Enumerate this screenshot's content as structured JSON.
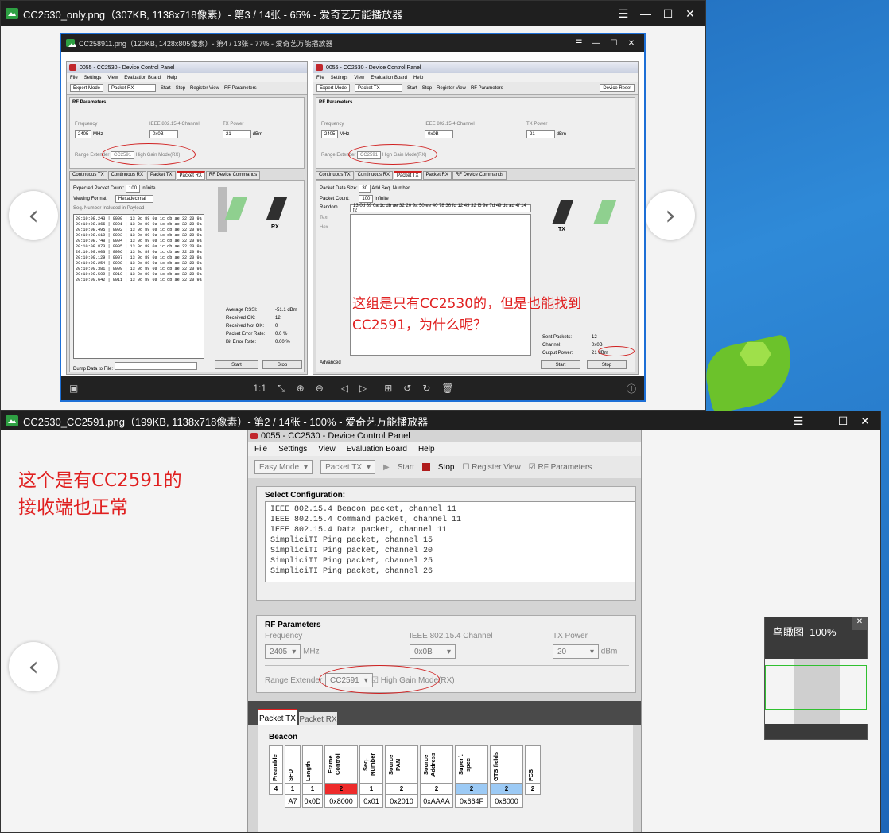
{
  "top_viewer": {
    "title": "CC2530_only.png（307KB, 1138x718像素）- 第3 / 14张 - 65% - 爱奇艺万能播放器",
    "controls": [
      "☰",
      "—",
      "☐",
      "✕"
    ],
    "prev": "‹",
    "next": "›",
    "inner_title": "CC258911.png（120KB, 1428x805像素）- 第4 / 13张 - 77% - 爱奇艺万能播放器",
    "toolbar": [
      "1:1",
      "⤡",
      "⊕",
      "⊖",
      "◁",
      "▷",
      "⊞",
      "↺",
      "↻",
      "🗑",
      "ⓘ"
    ],
    "left_panel": {
      "title": "0055 - CC2530 - Device Control Panel",
      "menu": [
        "File",
        "Settings",
        "View",
        "Evaluation Board",
        "Help"
      ],
      "mode": "Expert Mode",
      "packet": "Packet RX",
      "start": "Start",
      "stop": "Stop",
      "register_view": "Register View",
      "rf_params_cb": "RF Parameters",
      "rf_title": "RF Parameters",
      "freq_label": "Frequency",
      "freq": "2405",
      "freq_unit": "MHz",
      "chan_label": "IEEE 802.15.4 Channel",
      "chan": "0x0B",
      "txp_label": "TX Power",
      "txp": "21",
      "txp_unit": "dBm",
      "range_label": "Range Extender",
      "range": "CC2591",
      "hgm": "High Gain Mode(RX)",
      "tabs": [
        "Continuous TX",
        "Continuous RX",
        "Packet TX",
        "Packet RX",
        "RF Device Commands"
      ],
      "exp_count_label": "Expected Packet Count:",
      "exp_count": "100",
      "infinite": "Infinite",
      "view_fmt_label": "Viewing Format:",
      "view_fmt": "Hexadecimal",
      "seq_incl": "Seq. Number Included in Payload",
      "log": [
        "20:10:08.243 | 0000 | 13 0d 89 0a 1c db ae 32 20 9a 50 ee 40 78 36",
        "20:10:08.366 | 0001 | 13 0d 89 0a 1c db ae 32 20 9a 50 ee 40 78 36",
        "20:10:08.495 | 0002 | 13 0d 89 0a 1c db ae 32 20 9a 50 ee 40 78 36",
        "20:10:08.619 | 0003 | 13 0d 89 0a 1c db ae 32 20 9a 50 ee 40 78 36",
        "20:10:08.748 | 0004 | 13 0d 89 0a 1c db ae 32 20 9a 50 ee 40 78 36",
        "20:10:08.873 | 0005 | 13 0d 89 0a 1c db ae 32 20 9a 50 ee 40 78 36",
        "20:10:09.003 | 0006 | 13 0d 89 0a 1c db ae 32 20 9a 50 ee 40 78 36",
        "20:10:09.129 | 0007 | 13 0d 89 0a 1c db ae 32 20 9a 50 ee 40 78 36",
        "20:10:09.254 | 0008 | 13 0d 89 0a 1c db ae 32 20 9a 50 ee 40 78 36",
        "20:10:09.381 | 0009 | 13 0d 89 0a 1c db ae 32 20 9a 50 ee 40 78 36",
        "20:10:09.509 | 0010 | 13 0d 89 0a 1c db ae 32 20 9a 50 ee 40 78 36",
        "20:10:09.642 | 0011 | 13 0d 89 0a 1c db ae 32 20 9a 50 ee 40 78 36"
      ],
      "rx_label": "RX",
      "stats": [
        [
          "Average RSSI:",
          "-51.1 dBm"
        ],
        [
          "Received OK:",
          "12"
        ],
        [
          "Received Not OK:",
          "0"
        ],
        [
          "Packet Error Rate:",
          "0.0 %"
        ],
        [
          "Bit Error Rate:",
          "0.00 %"
        ]
      ],
      "dump_label": "Dump Data to File:",
      "btn_start": "Start",
      "btn_stop": "Stop"
    },
    "right_panel": {
      "title": "0056 - CC2530 - Device Control Panel",
      "menu": [
        "File",
        "Settings",
        "View",
        "Evaluation Board",
        "Help"
      ],
      "mode": "Expert Mode",
      "packet": "Packet TX",
      "start": "Start",
      "stop": "Stop",
      "register_view": "Register View",
      "rf_params_cb": "RF Parameters",
      "device_reset": "Device Reset",
      "rf_title": "RF Parameters",
      "freq_label": "Frequency",
      "freq": "2405",
      "freq_unit": "MHz",
      "chan_label": "IEEE 802.15.4 Channel",
      "chan": "0x0B",
      "txp_label": "TX Power",
      "txp": "21",
      "txp_unit": "dBm",
      "range_label": "Range Extender",
      "range": "CC2591",
      "hgm": "High Gain Mode(RX)",
      "tabs": [
        "Continuous TX",
        "Continuous RX",
        "Packet TX",
        "Packet RX",
        "RF Device Commands"
      ],
      "data_size_label": "Packet Data Size:",
      "data_size": "30",
      "add_seq": "Add Seq. Number",
      "count_label": "Packet Count:",
      "count": "100",
      "infinite": "Infinite",
      "random": "Random",
      "random_val": "13 0d 89 0a 1c db ae 32 20 9a 50 ee 40 78 36 fd 12 49 32 f6 9e 7d 49 dc ad 4f 14 f2",
      "text_opt": "Text",
      "hex_opt": "Hex",
      "tx_label": "TX",
      "stats": [
        [
          "Sent Packets:",
          "12"
        ],
        [
          "Channel:",
          "0x0B"
        ],
        [
          "Output Power:",
          "21 dBm"
        ]
      ],
      "advanced": "Advanced",
      "btn_start": "Start",
      "btn_stop": "Stop",
      "status_mid": "SmartRF1403",
      "status_right": "Radio State: 9.4"
    },
    "annotation_line1": "这组是只有CC2530的，但是也能找到",
    "annotation_line2": "CC2591，为什么呢？"
  },
  "bottom_viewer": {
    "title": "CC2530_CC2591.png（199KB, 1138x718像素）- 第2 / 14张 - 100% - 爱奇艺万能播放器",
    "controls": [
      "☰",
      "—",
      "☐",
      "✕"
    ],
    "prev": "‹",
    "annotation_line1": "这个是有CC2591的",
    "annotation_line2": "接收端也正常",
    "panel": {
      "title": "0055 - CC2530 - Device Control Panel",
      "menu": [
        "File",
        "Settings",
        "View",
        "Evaluation Board",
        "Help"
      ],
      "mode": "Easy Mode",
      "packet": "Packet TX",
      "start": "Start",
      "stop": "Stop",
      "register_view": "Register View",
      "rf_params_cb": "RF Parameters",
      "select_title": "Select Configuration:",
      "configs": [
        "IEEE 802.15.4 Beacon packet, channel 11",
        "IEEE 802.15.4 Command packet, channel 11",
        "IEEE 802.15.4 Data packet, channel 11",
        "SimpliciTI Ping packet, channel 15",
        "SimpliciTI Ping packet, channel 20",
        "SimpliciTI Ping packet, channel 25",
        "SimpliciTI Ping packet, channel 26"
      ],
      "rf_title": "RF Parameters",
      "freq_label": "Frequency",
      "freq": "2405",
      "freq_unit": "MHz",
      "chan_label": "IEEE 802.15.4 Channel",
      "chan": "0x0B",
      "txp_label": "TX Power",
      "txp": "20",
      "txp_unit": "dBm",
      "range_label": "Range Extender",
      "range": "CC2591",
      "hgm": "High Gain Mode(RX)",
      "tabs": [
        "Packet TX",
        "Packet RX"
      ],
      "beacon_title": "Beacon",
      "frame_fields": [
        {
          "name": "Preamble",
          "len": "4",
          "val": "",
          "color": "#ffffff"
        },
        {
          "name": "SFD",
          "len": "1",
          "val": "A7",
          "color": "#ffffff"
        },
        {
          "name": "Length",
          "len": "1",
          "val": "0x0D",
          "color": "#ffffff"
        },
        {
          "name": "Frame Control",
          "len": "2",
          "val": "0x8000",
          "color": "#ee2b2b"
        },
        {
          "name": "Seq. Number",
          "len": "1",
          "val": "0x01",
          "color": "#ffffff"
        },
        {
          "name": "Source PAN",
          "len": "2",
          "val": "0x2010",
          "color": "#ffffff"
        },
        {
          "name": "Source Address",
          "len": "2",
          "val": "0xAAAA",
          "color": "#ffffff"
        },
        {
          "name": "Superf. spec",
          "len": "2",
          "val": "0x664F",
          "color": "#9ccaf5"
        },
        {
          "name": "GTS fields",
          "len": "2",
          "val": "0x8000",
          "color": "#9ccaf5"
        },
        {
          "name": "FCS",
          "len": "2",
          "val": "",
          "color": "#ffffff"
        }
      ]
    },
    "thumb_label": "鸟瞰图",
    "thumb_zoom": "100%",
    "thumb_close": "✕"
  }
}
